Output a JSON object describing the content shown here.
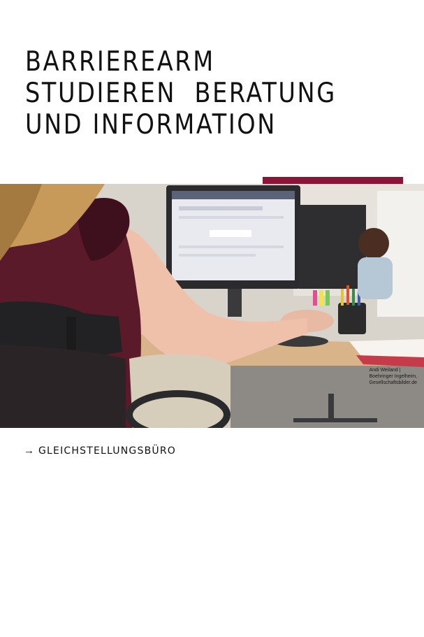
{
  "title": {
    "line1": "BARRIEREARM",
    "line2": "STUDIEREN  BERATUNG",
    "line3": "UND INFORMATION"
  },
  "colors": {
    "accent": "#8a1538",
    "text": "#111111"
  },
  "photo": {
    "credit": {
      "line1": "Andi Weiland |",
      "line2": "Boehringer Ingelheim,",
      "line3": "Gesellschaftsbilder.de"
    }
  },
  "link": {
    "icon": "arrow-right-icon",
    "label": "GLEICHSTELLUNGSBÜRO"
  }
}
